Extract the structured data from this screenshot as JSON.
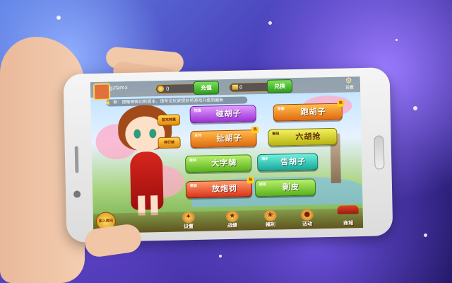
{
  "game": {
    "username": "gzfamx",
    "gold": {
      "value": "0",
      "label": "充值"
    },
    "diamond": {
      "value": "0",
      "label": "兑换"
    },
    "settings_label": "设置",
    "notice": "新：提醒晒微出新版本，请号位玩家提前将游戏升级到最新"
  },
  "badges": {
    "first_charge": "首充特惠",
    "rank": "排行榜"
  },
  "modes": [
    {
      "sub": "恍惚",
      "label": "碰胡子"
    },
    {
      "sub": "常德",
      "label": "跑胡子"
    },
    {
      "sub": "永州",
      "label": "扯胡子"
    },
    {
      "sub": "衡阳",
      "label": "六胡抢"
    },
    {
      "sub": "桂林",
      "label": "大字牌"
    },
    {
      "sub": "湘乡",
      "label": "告胡子"
    },
    {
      "sub": "娄底",
      "label": "放炮罚"
    },
    {
      "sub": "邵阳",
      "label": "剥皮"
    }
  ],
  "hot_badge": "热",
  "bottom_nav": [
    {
      "label": "设置"
    },
    {
      "label": "战绩"
    },
    {
      "label": "福利"
    },
    {
      "label": "活动"
    }
  ],
  "shop_label": "商城",
  "quick_join_label": "加入房间"
}
